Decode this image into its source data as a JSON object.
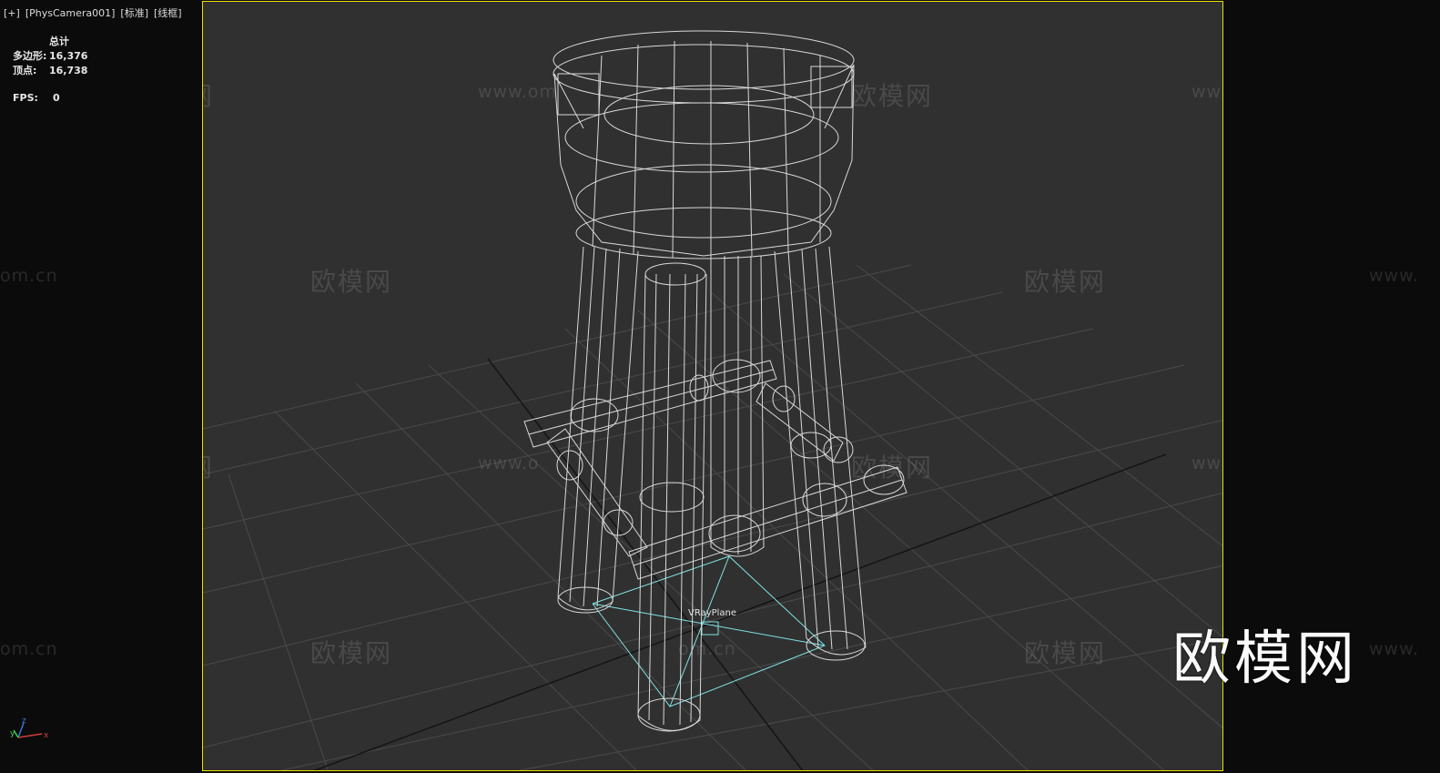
{
  "viewport": {
    "labels": [
      "[+]",
      "[PhysCamera001]",
      "[标准]",
      "[线框]"
    ]
  },
  "stats": {
    "header": "总计",
    "polygons_label": "多边形:",
    "polygons_value": "16,376",
    "vertices_label": "顶点:",
    "vertices_value": "16,738",
    "fps_label": "FPS:",
    "fps_value": "0"
  },
  "scene": {
    "object_label": "VRayPlane",
    "brand_watermark": "欧模网",
    "watermark_text": "欧模网",
    "watermark_url": "www.om.cn",
    "watermark_url_partial": "om.cn",
    "watermark_url_start": "www.",
    "watermark_url_cut": "www.om",
    "watermark_url_cut_start": "www.o"
  },
  "gizmo": {
    "x": "x",
    "y": "y",
    "z": "z"
  },
  "colors": {
    "safe_frame": "#e8e000",
    "viewport_bg": "#303030",
    "wire": "#d8d8d8",
    "grid": "#4a4a4a",
    "vray_plane": "#7fe3e3"
  }
}
